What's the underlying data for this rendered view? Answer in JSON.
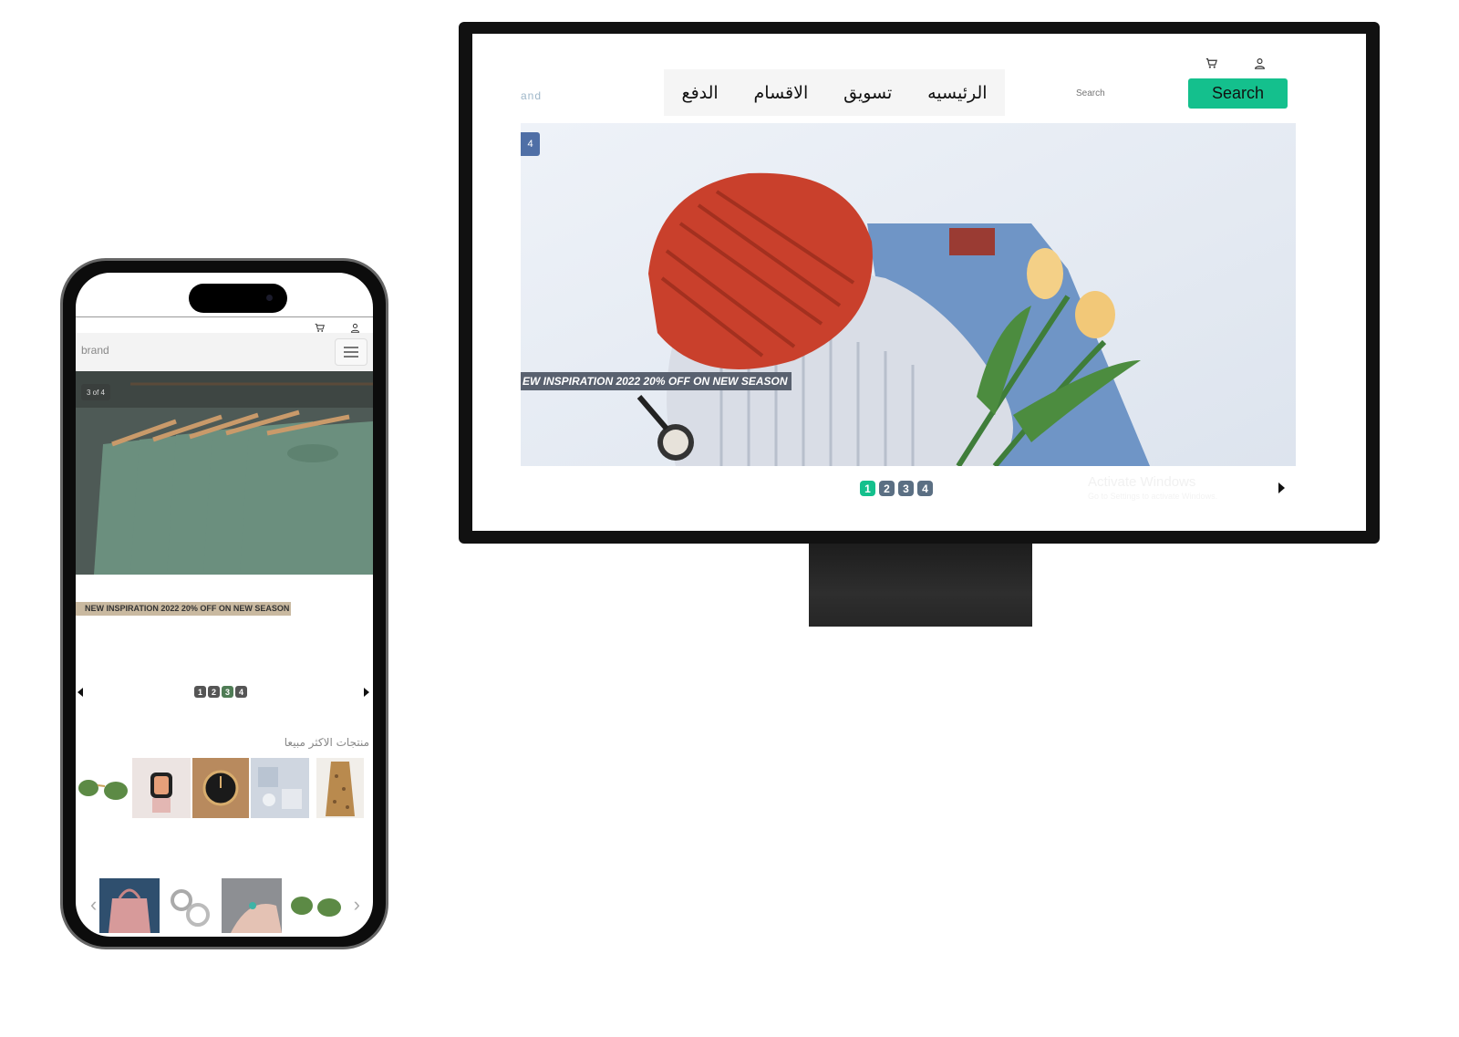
{
  "desktop": {
    "brand": "and",
    "nav": [
      "الرئيسيه",
      "تسويق",
      "الاقسام",
      "الدفع"
    ],
    "search_placeholder": "Search",
    "search_button": "Search",
    "slide_badge": "4",
    "banner": "EW INSPIRATION 2022 20% OFF ON NEW SEASON",
    "pagination": [
      "1",
      "2",
      "3",
      "4"
    ],
    "active_page": "1",
    "activate_title": "Activate Windows",
    "activate_sub": "Go to Settings to activate Windows."
  },
  "mobile": {
    "brand": "brand",
    "slide_badge": "3 of 4",
    "banner": "NEW INSPIRATION 2022 20% OFF ON NEW SEASON",
    "pagination": [
      "1",
      "2",
      "3",
      "4"
    ],
    "active_page": "3",
    "section_title": "منتجات الاكثر مبيعا"
  },
  "colors": {
    "accent": "#14c08d",
    "badge_blue": "#4f6fa6",
    "pagination_dot": "#5b6f83",
    "device_frame": "#111111"
  }
}
